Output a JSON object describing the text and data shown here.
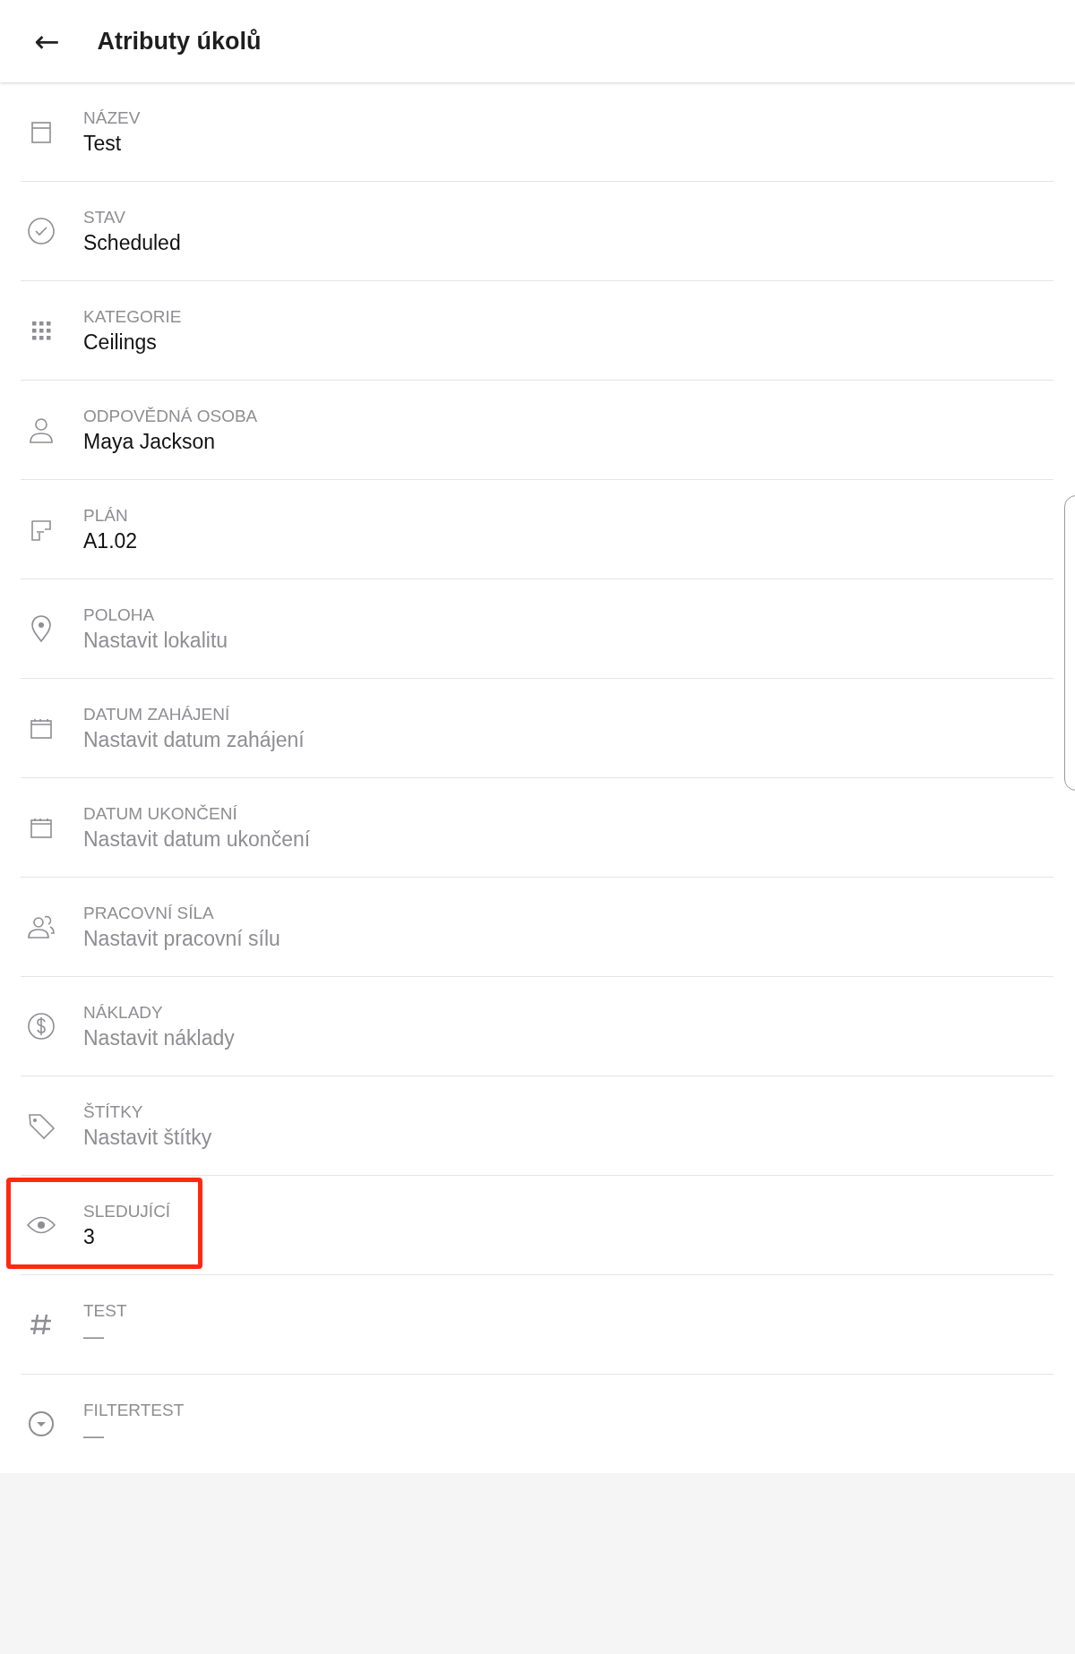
{
  "header": {
    "back_icon": "←",
    "title": "Atributy úkolů"
  },
  "attributes": [
    {
      "kind": "text",
      "label": "NÁZEV",
      "value": "Test",
      "filled": true,
      "highlighted": false
    },
    {
      "kind": "status",
      "label": "STAV",
      "value": "Scheduled",
      "filled": true,
      "highlighted": false
    },
    {
      "kind": "category",
      "label": "KATEGORIE",
      "value": "Ceilings",
      "filled": true,
      "highlighted": false
    },
    {
      "kind": "person",
      "label": "ODPOVĚDNÁ OSOBA",
      "value": "Maya Jackson",
      "filled": true,
      "highlighted": false
    },
    {
      "kind": "plan",
      "label": "PLÁN",
      "value": "A1.02",
      "filled": true,
      "highlighted": false
    },
    {
      "kind": "location",
      "label": "POLOHA",
      "value": "Nastavit lokalitu",
      "filled": false,
      "highlighted": false
    },
    {
      "kind": "date",
      "label": "DATUM ZAHÁJENÍ",
      "value": "Nastavit datum zahájení",
      "filled": false,
      "highlighted": false
    },
    {
      "kind": "date",
      "label": "DATUM UKONČENÍ",
      "value": "Nastavit datum ukončení",
      "filled": false,
      "highlighted": false
    },
    {
      "kind": "workforce",
      "label": "PRACOVNÍ SÍLA",
      "value": "Nastavit pracovní sílu",
      "filled": false,
      "highlighted": false
    },
    {
      "kind": "cost",
      "label": "NÁKLADY",
      "value": "Nastavit náklady",
      "filled": false,
      "highlighted": false
    },
    {
      "kind": "tags",
      "label": "ŠTÍTKY",
      "value": "Nastavit štítky",
      "filled": false,
      "highlighted": false
    },
    {
      "kind": "watchers",
      "label": "SLEDUJÍCÍ",
      "value": "3",
      "filled": true,
      "highlighted": true
    },
    {
      "kind": "number",
      "label": "TEST",
      "value": "—",
      "filled": false,
      "highlighted": false
    },
    {
      "kind": "dropdown",
      "label": "FILTERTEST",
      "value": "—",
      "filled": false,
      "highlighted": false
    }
  ]
}
